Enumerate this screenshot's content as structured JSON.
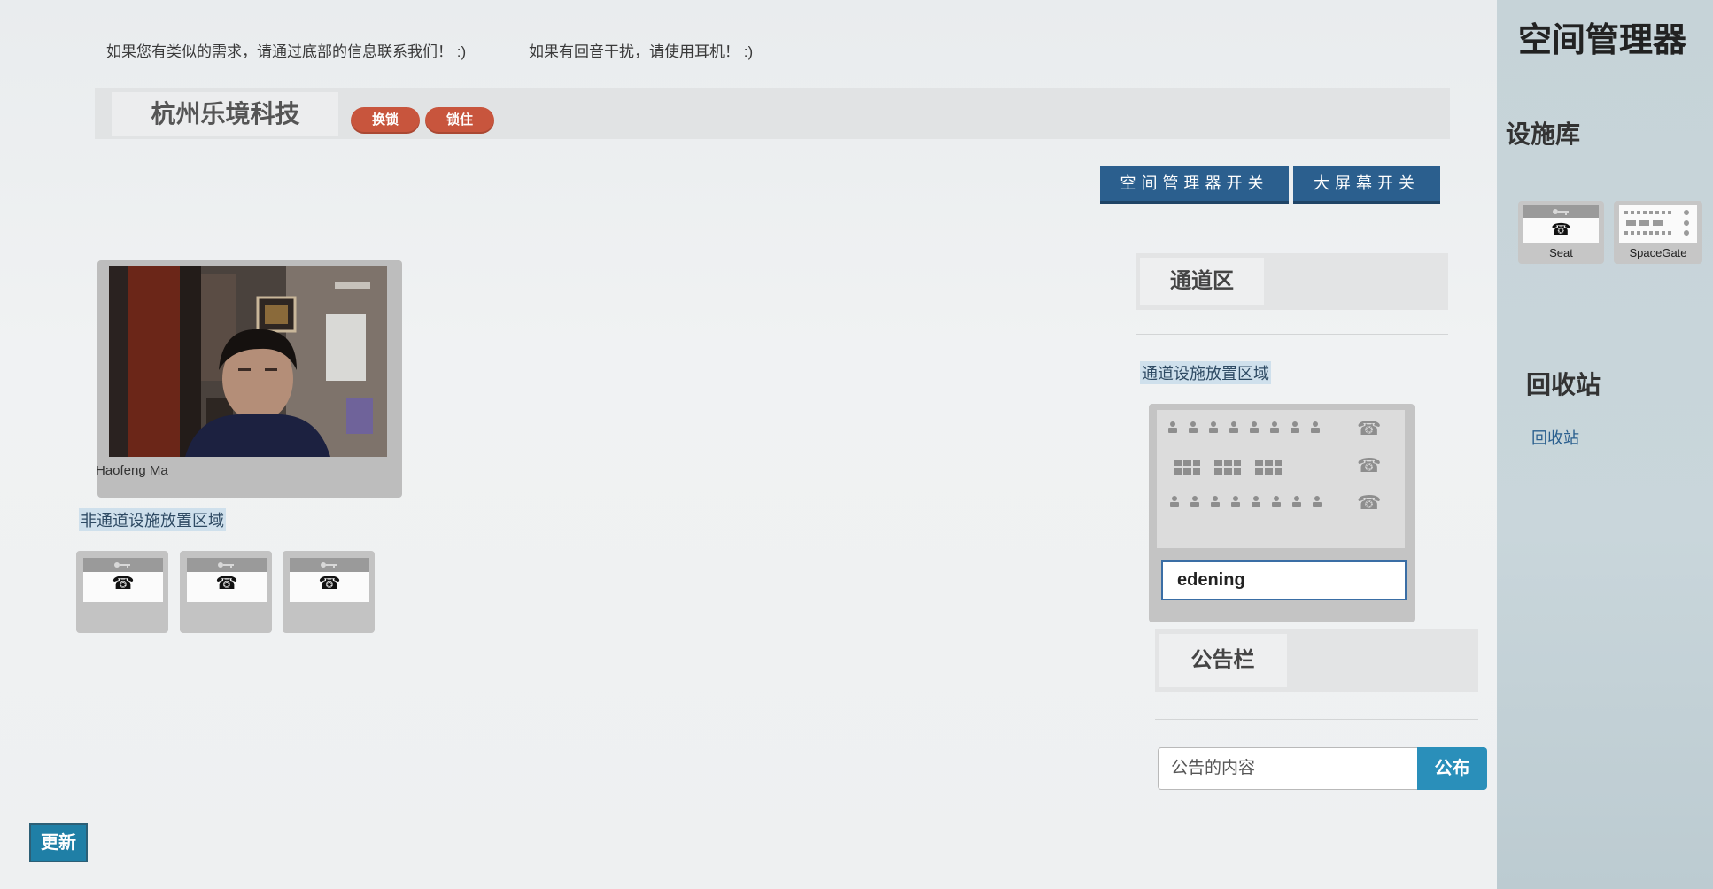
{
  "notice": {
    "contact": "如果您有类似的需求，请通过底部的信息联系我们！ :)",
    "echo": "如果有回音干扰，请使用耳机！ :)"
  },
  "header": {
    "title": "杭州乐境科技",
    "change_lock_label": "换锁",
    "lock_label": "锁住"
  },
  "toolbar": {
    "space_manager_toggle_label": "空间管理器开关",
    "big_screen_toggle_label": "大屏幕开关"
  },
  "video": {
    "participant_name": "Haofeng Ma"
  },
  "non_channel_area": {
    "label": "非通道设施放置区域",
    "seats": [
      {
        "icon": "telephone-icon"
      },
      {
        "icon": "telephone-icon"
      },
      {
        "icon": "telephone-icon"
      }
    ]
  },
  "channel_area": {
    "title": "通道区",
    "placement_label": "通道设施放置区域",
    "space_gate": {
      "name_value": "edening"
    }
  },
  "bulletin": {
    "title": "公告栏",
    "input_placeholder": "公告的内容",
    "publish_label": "公布"
  },
  "update_label": "更新",
  "sidebar": {
    "title": "空间管理器",
    "library_title": "设施库",
    "library_items": [
      {
        "label": "Seat",
        "icon": "telephone-icon"
      },
      {
        "label": "SpaceGate",
        "icon": "spacegate-icon"
      }
    ],
    "recycle_title": "回收站",
    "recycle_link": "回收站"
  },
  "colors": {
    "toggle_blue": "#2b5f8e",
    "lock_red": "#c8553d",
    "publish_blue": "#2a8fba",
    "update_blue": "#1f7fa6",
    "sidebar_bg": "#c9d6db"
  }
}
